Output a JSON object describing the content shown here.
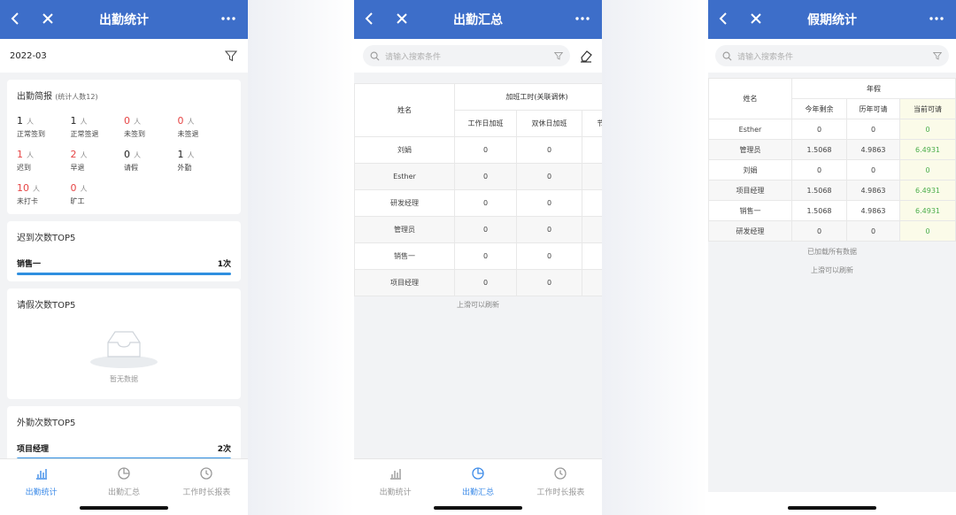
{
  "phone1": {
    "title": "出勤统计",
    "date": "2022-03",
    "summary_title": "出勤简报",
    "summary_sub": "(统计人数12)",
    "unit": "人",
    "stats": [
      {
        "num": "1",
        "label": "正常签到",
        "red": false
      },
      {
        "num": "1",
        "label": "正常签退",
        "red": false
      },
      {
        "num": "0",
        "label": "未签到",
        "red": true
      },
      {
        "num": "0",
        "label": "未签退",
        "red": true
      },
      {
        "num": "1",
        "label": "迟到",
        "red": true
      },
      {
        "num": "2",
        "label": "早退",
        "red": true
      },
      {
        "num": "0",
        "label": "请假",
        "red": false
      },
      {
        "num": "1",
        "label": "外勤",
        "red": false
      },
      {
        "num": "10",
        "label": "未打卡",
        "red": true
      },
      {
        "num": "0",
        "label": "旷工",
        "red": true
      }
    ],
    "late_title": "迟到次数TOP5",
    "late_name": "销售一",
    "late_count": "1次",
    "leave_title": "请假次数TOP5",
    "leave_empty": "暂无数据",
    "field_title": "外勤次数TOP5",
    "field_name": "项目经理",
    "field_count": "2次"
  },
  "phone2": {
    "title": "出勤汇总",
    "search_placeholder": "请输入搜索条件",
    "col_name": "姓名",
    "col_group": "加班工时(关联调休)",
    "col_a": "工作日加班",
    "col_b": "双休日加班",
    "col_c": "节",
    "rows": [
      {
        "name": "刘娟",
        "a": "0",
        "b": "0"
      },
      {
        "name": "Esther",
        "a": "0",
        "b": "0"
      },
      {
        "name": "研发经理",
        "a": "0",
        "b": "0"
      },
      {
        "name": "管理员",
        "a": "0",
        "b": "0"
      },
      {
        "name": "销售一",
        "a": "0",
        "b": "0"
      },
      {
        "name": "项目经理",
        "a": "0",
        "b": "0"
      }
    ],
    "footer": "上滑可以刷新"
  },
  "phone3": {
    "title": "假期统计",
    "search_placeholder": "请输入搜索条件",
    "col_name": "姓名",
    "col_group": "年假",
    "col_a": "今年剩余",
    "col_b": "历年可请",
    "col_c": "当前可请",
    "rows": [
      {
        "name": "Esther",
        "a": "0",
        "b": "0",
        "c": "0"
      },
      {
        "name": "管理员",
        "a": "1.5068",
        "b": "4.9863",
        "c": "6.4931"
      },
      {
        "name": "刘娟",
        "a": "0",
        "b": "0",
        "c": "0"
      },
      {
        "name": "项目经理",
        "a": "1.5068",
        "b": "4.9863",
        "c": "6.4931"
      },
      {
        "name": "销售一",
        "a": "1.5068",
        "b": "4.9863",
        "c": "6.4931"
      },
      {
        "name": "研发经理",
        "a": "0",
        "b": "0",
        "c": "0"
      }
    ],
    "loaded": "已加载所有数据",
    "footer": "上滑可以刷新"
  },
  "tabs": [
    "出勤统计",
    "出勤汇总",
    "工作时长报表"
  ],
  "colors": {
    "nav": "#3d6ec9",
    "accent": "#3d8be8",
    "red": "#e64545",
    "green": "#4cae4c"
  }
}
